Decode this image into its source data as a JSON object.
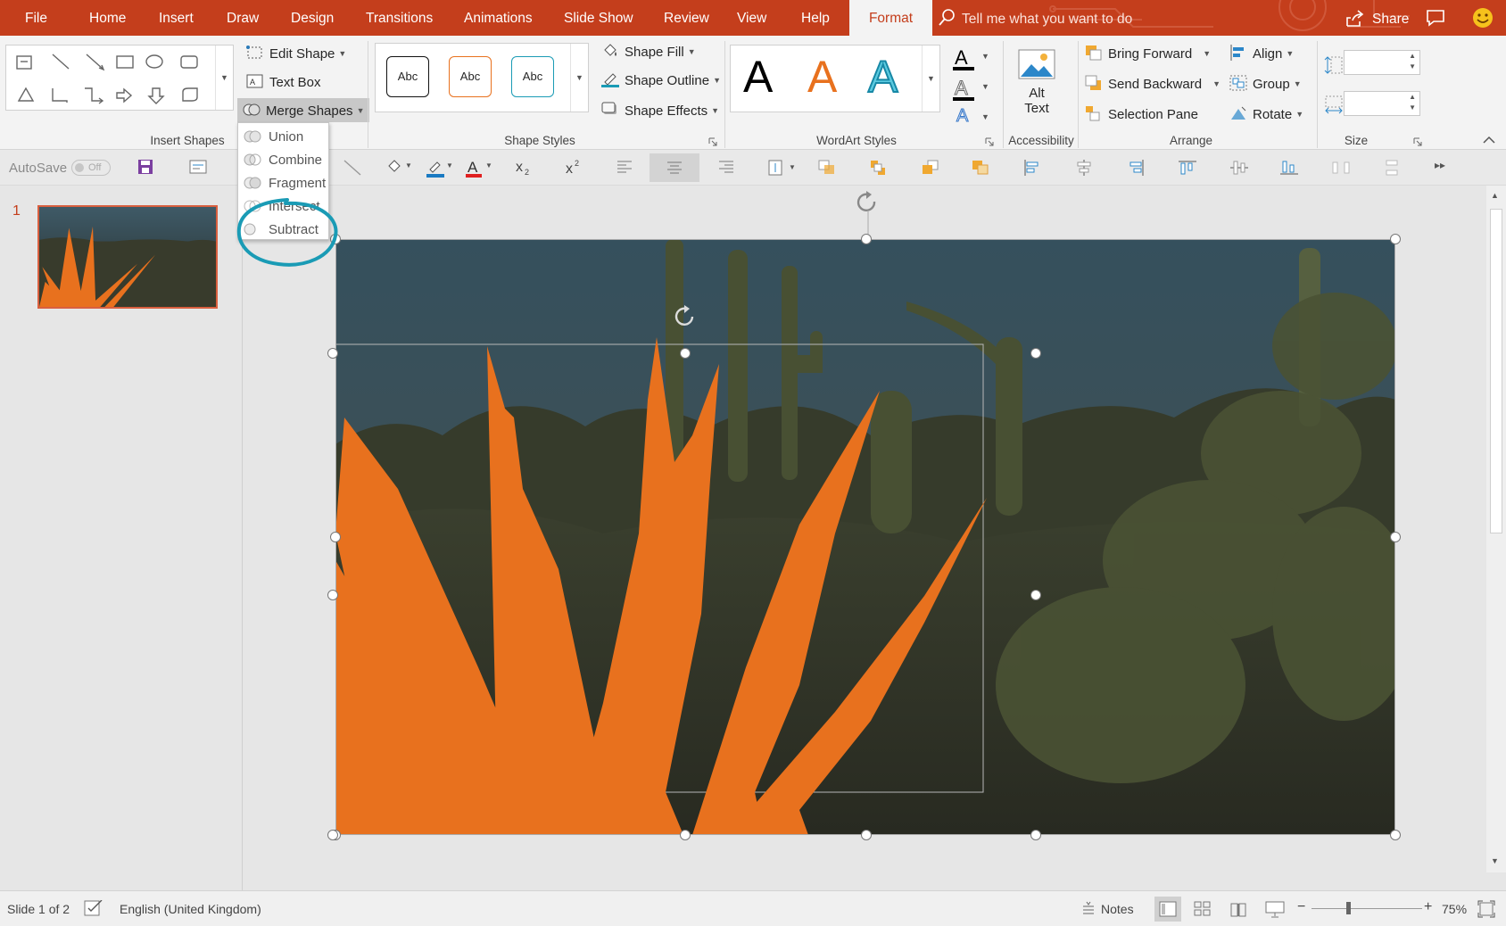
{
  "tabs": [
    {
      "label": "File"
    },
    {
      "label": "Home"
    },
    {
      "label": "Insert"
    },
    {
      "label": "Draw"
    },
    {
      "label": "Design"
    },
    {
      "label": "Transitions"
    },
    {
      "label": "Animations"
    },
    {
      "label": "Slide Show"
    },
    {
      "label": "Review"
    },
    {
      "label": "View"
    },
    {
      "label": "Help"
    },
    {
      "label": "Format"
    }
  ],
  "tellme": {
    "placeholder": "Tell me what you want to do"
  },
  "share": {
    "label": "Share"
  },
  "ribbon": {
    "insert_shapes": {
      "label": "Insert Shapes",
      "edit_shape": "Edit Shape",
      "text_box": "Text Box",
      "merge_shapes": "Merge Shapes"
    },
    "shape_styles": {
      "label": "Shape Styles",
      "samples": [
        "Abc",
        "Abc",
        "Abc"
      ],
      "shape_fill": "Shape Fill",
      "shape_outline": "Shape Outline",
      "shape_effects": "Shape Effects"
    },
    "wordart": {
      "label": "WordArt Styles",
      "letters": [
        "A",
        "A",
        "A"
      ]
    },
    "accessibility": {
      "label": "Accessibility",
      "alt_text_1": "Alt",
      "alt_text_2": "Text"
    },
    "arrange": {
      "label": "Arrange",
      "bring_forward": "Bring Forward",
      "send_backward": "Send Backward",
      "selection_pane": "Selection Pane",
      "align": "Align",
      "group": "Group",
      "rotate": "Rotate"
    },
    "size": {
      "label": "Size"
    }
  },
  "merge_menu": {
    "items": [
      {
        "label": "Union"
      },
      {
        "label": "Combine"
      },
      {
        "label": "Fragment"
      },
      {
        "label": "Intersect"
      },
      {
        "label": "Subtract"
      }
    ]
  },
  "qat": {
    "autosave": "AutoSave",
    "autosave_state": "Off"
  },
  "slides": {
    "number": "1"
  },
  "status": {
    "slide": "Slide 1 of 2",
    "language": "English (United Kingdom)",
    "notes": "Notes",
    "zoom": "75%"
  },
  "colors": {
    "accent": "#c43e1c",
    "shape_orange": "#e8711e",
    "highlight_circle": "#1a9bb5"
  }
}
